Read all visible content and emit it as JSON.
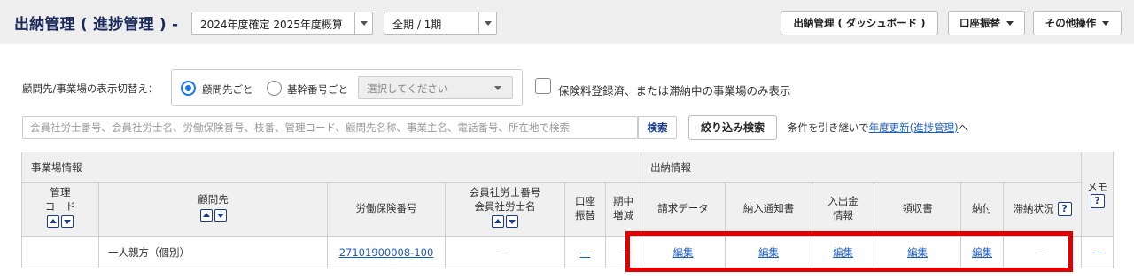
{
  "header": {
    "title": "出納管理 ( 進捗管理 ) -",
    "year_select": "2024年度確定 2025年度概算",
    "period_select": "全期 / 1期",
    "dashboard_button": "出納管理 ( ダッシュボード )",
    "transfer_button": "口座振替",
    "other_button": "その他操作"
  },
  "filters": {
    "switch_label": "顧問先/事業場の表示切替え：",
    "radio_client": "顧問先ごと",
    "radio_base": "基幹番号ごと",
    "select_placeholder": "選択してください",
    "checkbox_label": "保険料登録済、または滞納中の事業場のみ表示"
  },
  "search": {
    "placeholder": "会員社労士番号、会員社労士名、労働保険番号、枝番、管理コード、顧問先名称、事業主名、電話番号、所在地で検索",
    "search_button": "検索",
    "filter_button": "絞り込み検索",
    "inherit_prefix": "条件を引き継いで",
    "inherit_link": "年度更新(進捗管理)",
    "inherit_suffix": "へ"
  },
  "table": {
    "section_site": "事業場情報",
    "section_cash": "出納情報",
    "col_code_1": "管理",
    "col_code_2": "コード",
    "col_client": "顧問先",
    "col_insurance": "労働保険番号",
    "col_member_1": "会員社労士番号",
    "col_member_2": "会員社労士名",
    "col_account_1": "口座",
    "col_account_2": "振替",
    "col_mid_1": "期中",
    "col_mid_2": "増減",
    "col_billing": "請求データ",
    "col_notice": "納入通知書",
    "col_inout_1": "入出金",
    "col_inout_2": "情報",
    "col_receipt": "領収書",
    "col_payment": "納付",
    "col_arrears": "滞納状況",
    "col_memo": "メモ",
    "help_mark": "?",
    "row": {
      "code": "",
      "client": "一人親方（個別）",
      "insurance_no": "27101900008-100",
      "member": "—",
      "account": "—",
      "mid": "—",
      "billing": "編集",
      "notice": "編集",
      "inout": "編集",
      "receipt": "編集",
      "payment": "編集",
      "arrears": "—",
      "memo": "—"
    }
  }
}
